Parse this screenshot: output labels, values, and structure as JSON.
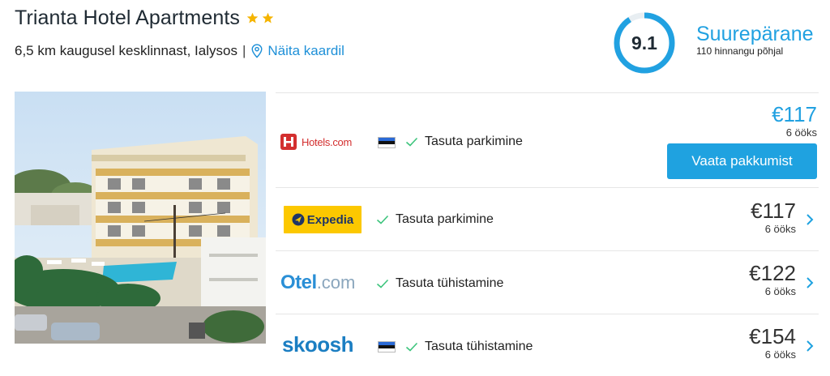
{
  "hotel": {
    "name": "Trianta Hotel Apartments",
    "stars": 2,
    "distance": "6,5 km kaugusel kesklinnast, Ialysos",
    "separator": "|",
    "map_link": "Näita kaardil"
  },
  "rating": {
    "score": "9.1",
    "score_fraction": 0.91,
    "label": "Suurepärane",
    "count": "110 hinnangu põhjal"
  },
  "offers": [
    {
      "provider": "Hotels.com",
      "logo_text": "Hotels.com",
      "has_flag": true,
      "feature": "Tasuta parkimine",
      "price": "€117",
      "nights": "6 ööks",
      "button": "Vaata pakkumist"
    },
    {
      "provider": "Expedia",
      "logo_text": "Expedia",
      "has_flag": false,
      "feature": "Tasuta parkimine",
      "price": "€117",
      "nights": "6 ööks"
    },
    {
      "provider": "Otel.com",
      "logo_text_a": "Otel",
      "logo_text_b": ".com",
      "has_flag": false,
      "feature": "Tasuta tühistamine",
      "price": "€122",
      "nights": "6 ööks"
    },
    {
      "provider": "skoosh",
      "logo_text": "skoosh",
      "has_flag": true,
      "feature": "Tasuta tühistamine",
      "price": "€154",
      "nights": "6 ööks"
    }
  ],
  "colors": {
    "accent": "#21a1e1",
    "star": "#f5b400",
    "check": "#3cc47c",
    "hotels_red": "#d32f2f",
    "expedia_yellow": "#fcc800",
    "expedia_navy": "#1f3566",
    "otel_blue": "#2a8fd6",
    "skoosh_blue": "#1b7ec2"
  },
  "icons": {
    "star": "star-icon",
    "map": "map-pin-icon",
    "check": "check-icon",
    "chevron": "chevron-right-icon",
    "flag": "estonia-flag-icon"
  }
}
